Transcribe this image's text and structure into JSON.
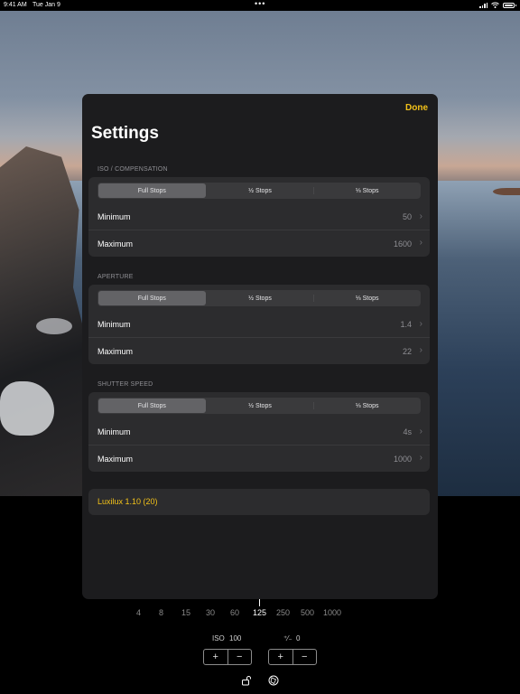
{
  "status_bar": {
    "time": "9:41 AM",
    "date": "Tue Jan 9",
    "multitask_dots": "•••"
  },
  "modal": {
    "done_label": "Done",
    "title": "Settings",
    "sections": [
      {
        "header": "ISO / COMPENSATION",
        "segments": [
          "Full Stops",
          "½ Stops",
          "⅓ Stops"
        ],
        "selected_segment": "Full Stops",
        "rows": [
          {
            "label": "Minimum",
            "value": "50"
          },
          {
            "label": "Maximum",
            "value": "1600"
          }
        ]
      },
      {
        "header": "APERTURE",
        "segments": [
          "Full Stops",
          "½ Stops",
          "⅓ Stops"
        ],
        "selected_segment": "Full Stops",
        "rows": [
          {
            "label": "Minimum",
            "value": "1.4"
          },
          {
            "label": "Maximum",
            "value": "22"
          }
        ]
      },
      {
        "header": "SHUTTER SPEED",
        "segments": [
          "Full Stops",
          "½ Stops",
          "⅓ Stops"
        ],
        "selected_segment": "Full Stops",
        "rows": [
          {
            "label": "Minimum",
            "value": "4s"
          },
          {
            "label": "Maximum",
            "value": "1000"
          }
        ]
      }
    ],
    "version_label": "Luxilux 1.10 (20)"
  },
  "shutter_scale": {
    "values": [
      "4",
      "8",
      "15",
      "30",
      "60",
      "125",
      "250",
      "500",
      "1000"
    ],
    "selected": "125"
  },
  "controls": {
    "iso_label": "ISO",
    "iso_value": "100",
    "comp_label": "⁺⁄₋",
    "comp_value": "0",
    "plus": "+",
    "minus": "−"
  },
  "colors": {
    "accent": "#f3c219",
    "modal_bg": "#1c1c1e",
    "group_bg": "#2c2c2e"
  },
  "icons": [
    "chevron-right-icon",
    "lock-icon",
    "aperture-icon",
    "wifi-icon",
    "signal-icon",
    "battery-icon"
  ]
}
